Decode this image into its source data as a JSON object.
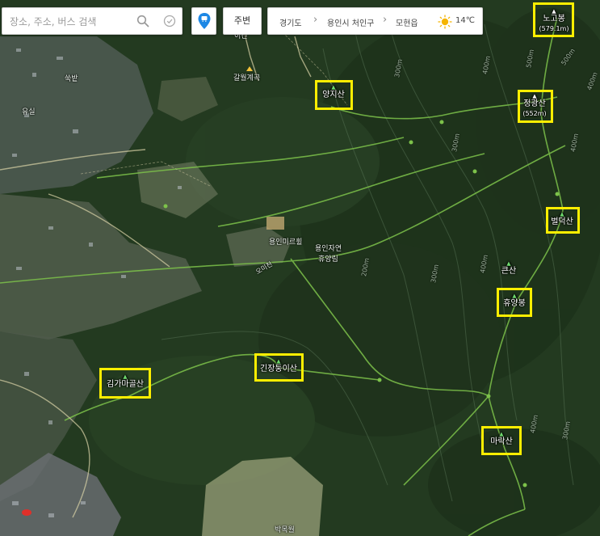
{
  "search": {
    "placeholder": "장소, 주소, 버스 검색",
    "search_icon": "search-icon",
    "directions_icon": "directions-icon"
  },
  "location_button_icon": "map-pin-icon",
  "around_button": "주변",
  "breadcrumb": {
    "province": "경기도",
    "city": "용인시 처인구",
    "district": "모현읍"
  },
  "weather": {
    "icon": "sun-icon",
    "temperature": "14℃"
  },
  "peaks": {
    "nogobong": {
      "name": "노고봉",
      "elevation": "(579.1m)"
    },
    "jeonggwangsan": {
      "name": "정광산",
      "elevation": "(552m)"
    },
    "yangjisan": {
      "name": "양지산"
    },
    "beoldeoksan": {
      "name": "벌덕산"
    },
    "keunsan": {
      "name": "큰산"
    },
    "hyuyangbong": {
      "name": "휴양봉"
    },
    "kinjangdongisan": {
      "name": "긴장둥이산"
    },
    "gimgamagolsan": {
      "name": "김가마골산"
    },
    "marksan": {
      "name": "마락산"
    }
  },
  "places": {
    "galwol": "갈월계곡",
    "yongin_mireul": "용인미르휠",
    "recreation_forest_1": "용인자연",
    "recreation_forest_2": "휴양림",
    "ssukbat": "쑥밭",
    "yusil": "유실",
    "bakmokwol": "박목월",
    "igyeon": "이건",
    "road_label": "오미천"
  },
  "elevation_labels": {
    "e1": "300m",
    "e2": "400m",
    "e3": "500m",
    "e4": "500m",
    "e5": "400m",
    "e6": "300m",
    "e7": "400m",
    "e8": "200m",
    "e9": "300m",
    "e10": "400m",
    "e11": "400m",
    "e12": "300m"
  },
  "highlight_color": "#ffee00",
  "trail_color": "#7dc24a",
  "brand_color": "#1e88e5"
}
